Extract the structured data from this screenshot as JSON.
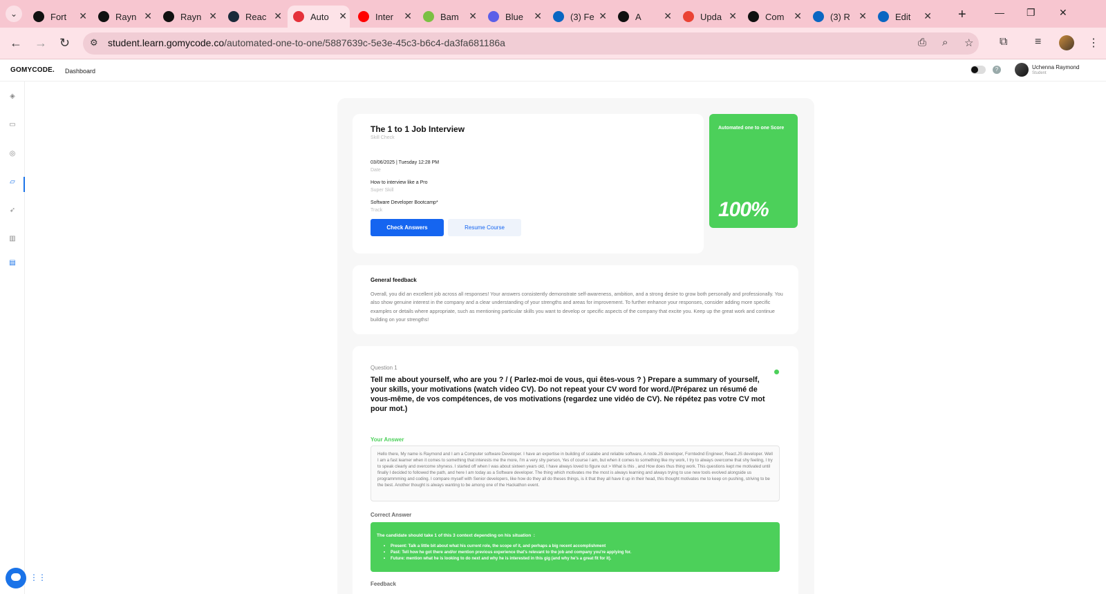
{
  "browser": {
    "tabs": [
      {
        "label": "Fort",
        "icon": "threads-icon",
        "color": "#111111"
      },
      {
        "label": "Rayn",
        "icon": "github-icon",
        "color": "#111111"
      },
      {
        "label": "Rayn",
        "icon": "github-icon",
        "color": "#111111"
      },
      {
        "label": "Reac",
        "icon": "react-icon",
        "color": "#1b2a3a"
      },
      {
        "label": "Auto",
        "icon": "gomycode-icon",
        "color": "#e5323b",
        "active": true
      },
      {
        "label": "Inter",
        "icon": "youtube-icon",
        "color": "#ff0000"
      },
      {
        "label": "Bam",
        "icon": "bambam-icon",
        "color": "#7bc043"
      },
      {
        "label": "Blue",
        "icon": "blue-app-icon",
        "color": "#5b5fe8"
      },
      {
        "label": "(3) Fe",
        "icon": "linkedin-icon",
        "color": "#0a66c2"
      },
      {
        "label": "A",
        "icon": "medium-icon",
        "color": "#111111"
      },
      {
        "label": "Upda",
        "icon": "gmail-icon",
        "color": "#ea4335"
      },
      {
        "label": "Com",
        "icon": "medium-icon",
        "color": "#111111"
      },
      {
        "label": "(3) R",
        "icon": "linkedin-icon",
        "color": "#0a66c2"
      },
      {
        "label": "Edit",
        "icon": "linkedin-icon",
        "color": "#0a66c2"
      }
    ],
    "url_domain": "student.learn.gomycode.co",
    "url_path": "/automated-one-to-one/5887639c-5e3e-45c3-b6c4-da3fa681186a"
  },
  "app": {
    "logo": "GOMYCODE.",
    "nav_dashboard": "Dashboard",
    "help": "?",
    "user_name": "Uchenna Raymond",
    "user_role": "Student"
  },
  "info": {
    "title": "The 1 to 1 Job Interview",
    "subtitle": "Skill Check",
    "date_value": "03/06/2025 | Tuesday 12:28 PM",
    "date_label": "Date",
    "super_skill_value": "How to interview like a Pro",
    "super_skill_label": "Super Skill",
    "track_value": "Software Developer Bootcamp*",
    "track_label": "Track",
    "check_answers": "Check Answers",
    "resume_course": "Resume Course"
  },
  "score": {
    "label": "Automated one to one Score",
    "value": "100%",
    "color": "#4cd05a"
  },
  "general_feedback": {
    "title": "General feedback",
    "text": "Overall, you did an excellent job across all responses! Your answers consistently demonstrate self-awareness, ambition, and a strong desire to grow both personally and professionally. You also show genuine interest in the company and a clear understanding of your strengths and areas for improvement. To further enhance your responses, consider adding more specific examples or details where appropriate, such as mentioning particular skills you want to develop or specific aspects of the company that excite you. Keep up the great work and continue building on your strengths!"
  },
  "question": {
    "number_label": "Question 1",
    "text": "Tell me about yourself, who are you ? / ( Parlez-moi de vous, qui êtes-vous ? ) Prepare a summary of yourself, your skills, your motivations (watch video CV). Do not repeat your CV word for word./(Préparez un résumé de vous-même, de vos compétences, de vos motivations (regardez une vidéo de CV). Ne répétez pas votre CV mot pour mot.)",
    "your_answer_label": "Your Answer",
    "your_answer": "Hello there, My name is Raymond and I am a Computer software Developer. I have an expertise in building of scalabe and reliable software, A node.JS developer, Forntednd Engineer, React.JS developer. Well I am a fast learner when it comes to something that interests me the more, I'm a very shy person, Yes of course I am, but when it comes to something like my work, I try to always overcome that shy feeling, I try to speak clearly and overcome shyness. I started off when I was about sixteen years old, I have always loved to figure out > What is this , and How does thus thing work. This questions kept me motivated until finally I decided to followed the path, and here I am today as a Software developer. The thing which motivates me the most is always learning and always trying to use new tools evolved alongside us programmming and coding. I compare myself with Senior developers, like how do they all do theses things, is it that they all have it up in their head, this thought motivates me to keep on pushing, striving to be the best. Another thought is always wanting to be among one of the Hackathon event.",
    "correct_answer_label": "Correct Answer",
    "correct_intro": "The candidate should take 1 of this 3 context depending on his situation  :",
    "correct_points": [
      "Present: Talk a little bit about what his current role, the scope of it, and perhaps a big recent accomplishment",
      "Past: Tell how he got there and/or mention previous experience that's relevant to the job and company you're applying for.",
      "Future:  mention what he is looking to do next and why he is interested in this gig (and why he's a great fit for it)."
    ],
    "feedback_label": "Feedback"
  }
}
